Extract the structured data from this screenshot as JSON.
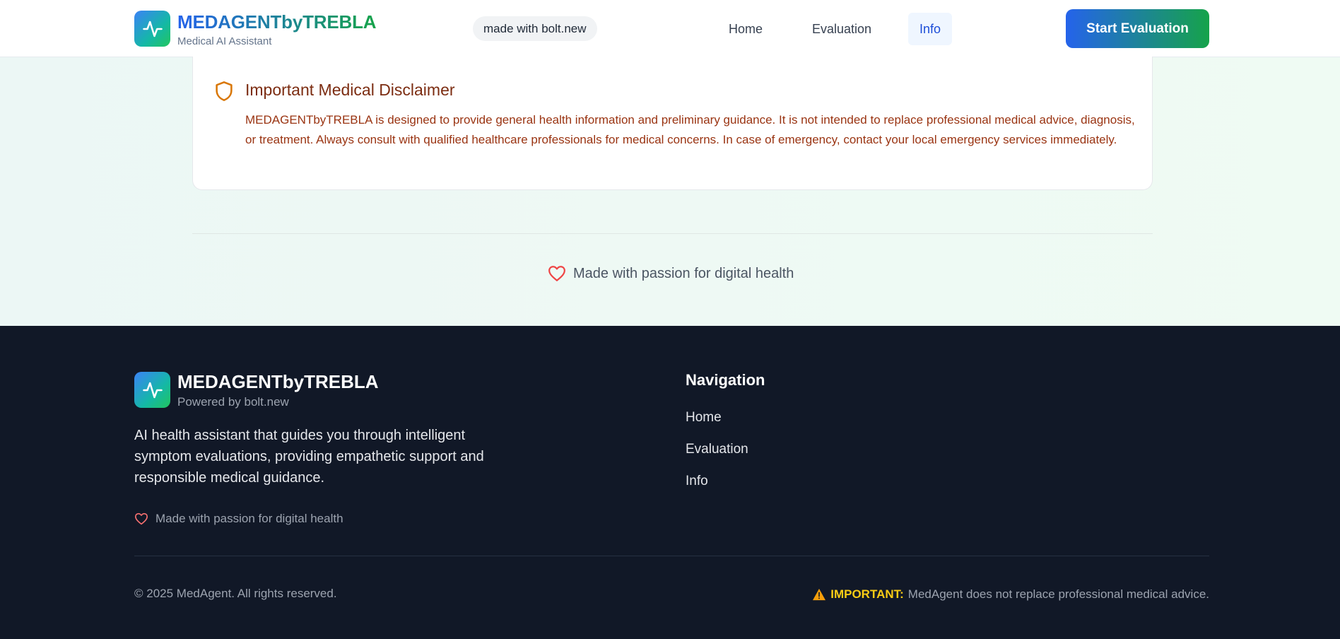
{
  "header": {
    "brand": "MEDAGENTbyTREBLA",
    "tagline": "Medical AI Assistant",
    "badge": "made with bolt.new",
    "nav": [
      {
        "label": "Home"
      },
      {
        "label": "Evaluation"
      },
      {
        "label": "Info",
        "active": true
      }
    ],
    "cta_label": "Start Evaluation"
  },
  "disclaimer": {
    "title": "Important Medical Disclaimer",
    "text": "MEDAGENTbyTREBLA is designed to provide general health information and preliminary guidance. It is not intended to replace professional medical advice, diagnosis, or treatment. Always consult with qualified healthcare professionals for medical concerns. In case of emergency, contact your local emergency services immediately."
  },
  "passion_note": "Made with passion for digital health",
  "footer": {
    "brand": "MEDAGENTbyTREBLA",
    "powered_by": "Powered by bolt.new",
    "description": "AI health assistant that guides you through intelligent symptom evaluations, providing empathetic support and responsible medical guidance.",
    "passion_note": "Made with passion for digital health",
    "nav_title": "Navigation",
    "nav_links": [
      {
        "label": "Home"
      },
      {
        "label": "Evaluation"
      },
      {
        "label": "Info"
      }
    ],
    "copyright": "© 2025 MedAgent. All rights reserved.",
    "warning_label": "IMPORTANT:",
    "warning_text": "MedAgent does not replace professional medical advice."
  },
  "icons": {
    "logo": "activity-pulse-icon",
    "disclaimer": "shield-icon",
    "passion": "heart-icon",
    "warning": "warning-triangle-icon"
  },
  "colors": {
    "brand_blue": "#2563eb",
    "brand_green": "#16a34a",
    "footer_bg": "#111827",
    "disclaimer_text": "#9a3412",
    "warning": "#facc15",
    "heart": "#ef4444"
  }
}
